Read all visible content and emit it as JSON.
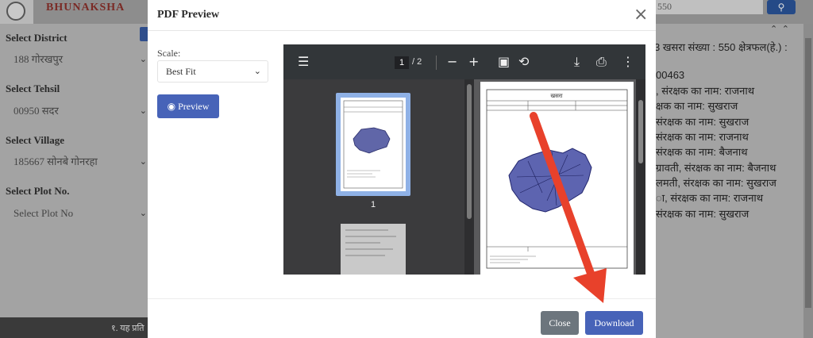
{
  "background": {
    "brand": "BHUNAKSHA",
    "search_value": "550",
    "sidebar": [
      {
        "label": "Select District",
        "value": "188 गोरखपुर"
      },
      {
        "label": "Select Tehsil",
        "value": "00950 सदर"
      },
      {
        "label": "Select Village",
        "value": "185667 सोनबे गोनरहा"
      },
      {
        "label": "Select Plot No.",
        "value": "Select Plot No"
      }
    ],
    "right_lines": [
      "3 खसरा संख्या : 550 क्षेत्रफल(हे.) :",
      "00463",
      ", संरक्षक का नाम: राजनाथ",
      "क्षक का नाम: सुखराज",
      "संरक्षक का नाम: सुखराज",
      "संरक्षक का नाम: राजनाथ",
      "संरक्षक का नाम: बैजनाथ",
      "ग्रावती, संरक्षक का नाम: बैजनाथ",
      "लमती, संरक्षक का नाम: सुखराज",
      "ा, संरक्षक का नाम: राजनाथ",
      "संरक्षक का नाम: सुखराज"
    ],
    "footer_text": "१. यह प्रति"
  },
  "modal": {
    "title": "PDF Preview",
    "close_symbol": "×",
    "scale_label": "Scale:",
    "scale_value": "Best Fit",
    "preview_label": "Preview",
    "close_button": "Close",
    "download_button": "Download"
  },
  "pdf_viewer": {
    "current_page": "1",
    "total_pages": "/ 2",
    "thumb_label": "1",
    "page_heading": "खसरा"
  },
  "colors": {
    "primary": "#4763b8",
    "secondary": "#6c757d",
    "annotation_arrow": "#e8412b"
  }
}
